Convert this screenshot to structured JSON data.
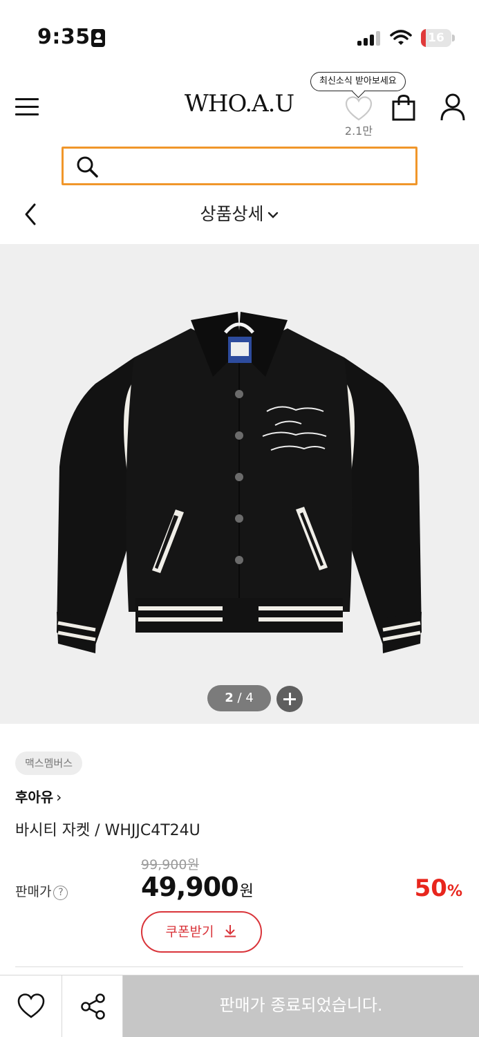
{
  "status_bar": {
    "time": "9:35",
    "battery_percent": 16,
    "battery_label": "16",
    "battery_color": "#e03a3a"
  },
  "header": {
    "menu_icon": "hamburger-menu-icon",
    "logo": "WHO.A.U",
    "tooltip": "최신소식 받아보세요",
    "wish_count": "2.1만",
    "bag_icon": "shopping-bag-icon",
    "user_icon": "user-icon"
  },
  "search": {
    "placeholder": "",
    "value": "",
    "border_color": "#f0962a"
  },
  "subnav": {
    "title": "상품상세"
  },
  "gallery": {
    "current": "2",
    "total": "4",
    "separator": "/"
  },
  "product": {
    "badge": "맥스멤버스",
    "brand": "후아유",
    "name": "바시티 자켓 / WHJJC4T24U",
    "original_price": "99,900원",
    "price_label": "판매가",
    "sale_price": "49,900",
    "currency": "원",
    "discount_value": "50",
    "discount_unit": "%",
    "accent_color": "#e8261d"
  },
  "coupon": {
    "label": "쿠폰받기"
  },
  "bottom_bar": {
    "soldout_label": "판매가 종료되었습니다."
  }
}
